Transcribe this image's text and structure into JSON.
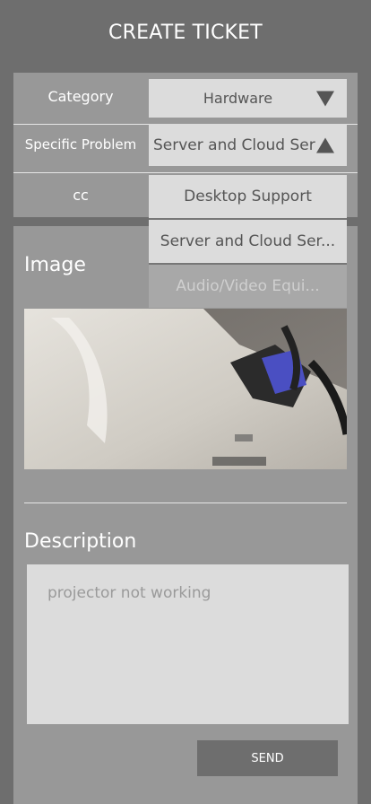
{
  "header": {
    "title": "CREATE TICKET"
  },
  "form": {
    "category": {
      "label": "Category",
      "value": "Hardware",
      "icon": "chevron-down-icon"
    },
    "specific_problem": {
      "label": "Specific Problem",
      "value": "Server and Cloud Ser",
      "icon": "chevron-up-icon"
    },
    "cc": {
      "label": "cc"
    }
  },
  "dropdown": {
    "options": [
      {
        "label": "Desktop Support",
        "state": "normal"
      },
      {
        "label": "Server and Cloud Ser...",
        "state": "normal"
      },
      {
        "label": "Audio/Video Equi...",
        "state": "disabled"
      }
    ]
  },
  "image_section": {
    "label": "Image"
  },
  "description": {
    "label": "Description",
    "placeholder": "projector not working"
  },
  "actions": {
    "send_label": "SEND"
  },
  "colors": {
    "background": "#6e6e6e",
    "panel": "#989898",
    "field": "#dcdcdc",
    "button": "#6e6e6e"
  }
}
